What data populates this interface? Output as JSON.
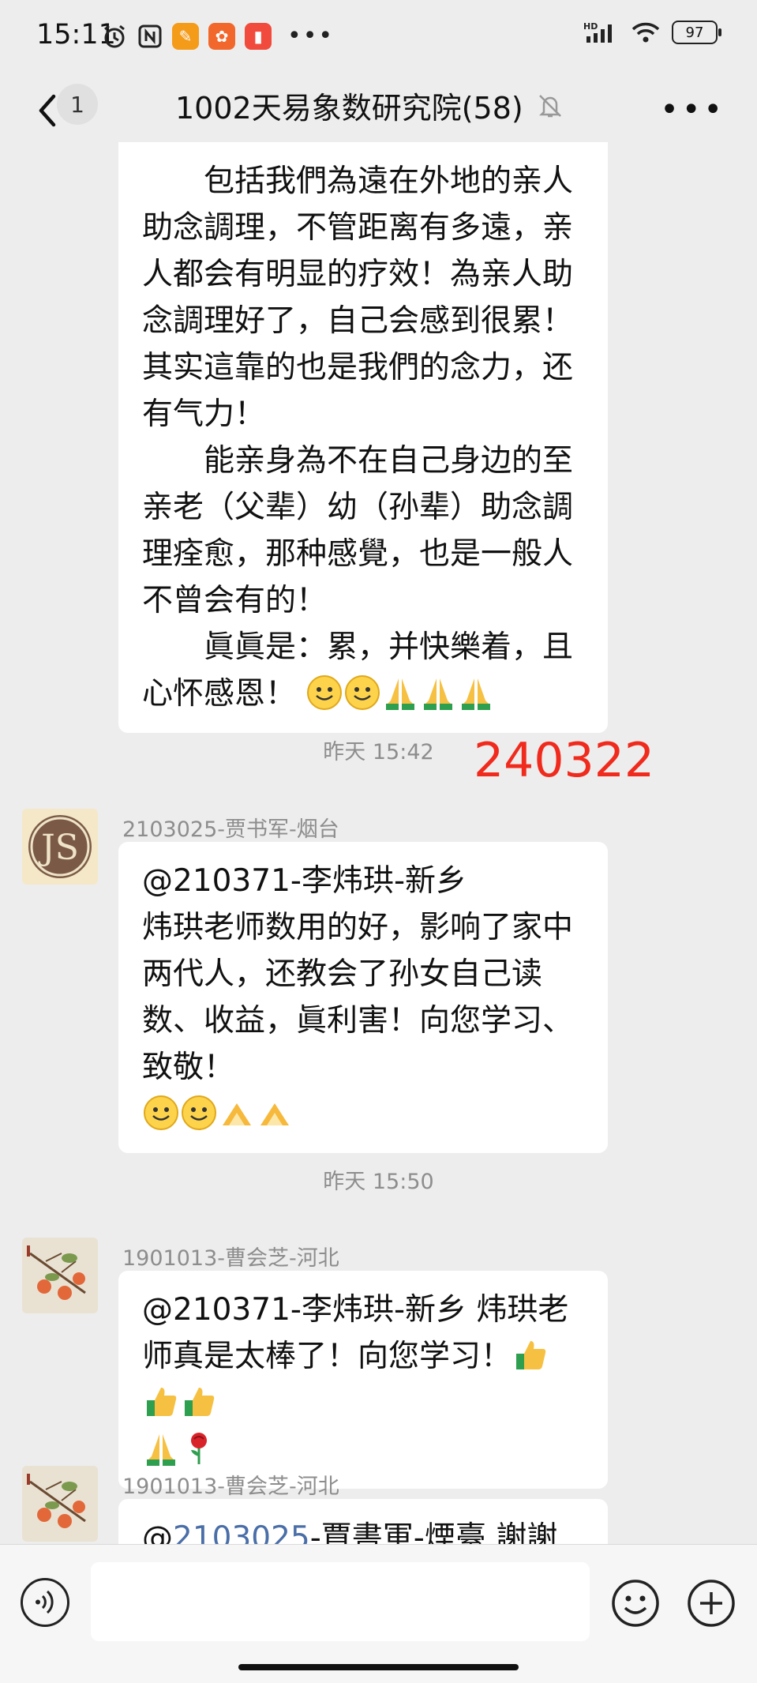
{
  "status_bar": {
    "time": "15:11",
    "battery": "97",
    "network": "HD"
  },
  "nav": {
    "unread_count": "1",
    "title": "1002天易象数研究院(58)"
  },
  "messages": {
    "m1": {
      "para1": "包括我們為遠在外地的亲人助念調理，不管距离有多遠，亲人都会有明显的疗效！為亲人助念調理好了，自己会感到很累！其实這靠的也是我們的念力，还有气力！",
      "para2": "能亲身為不在自己身边的至亲老（父辈）幼（孙辈）助念調理痊愈，那种感覺，也是一般人不曾会有的！",
      "para3": "眞眞是：累，并快樂着，且心怀感恩！"
    },
    "sep1": "昨天 15:42",
    "stamp": "240322",
    "m2": {
      "sender": "2103025-贾书军-烟台",
      "line1": "@210371-李炜珙-新乡",
      "body": "炜珙老师数用的好，影响了家中两代人，还教会了孙女自己读数、收益，眞利害！向您学习、致敬！"
    },
    "sep2": "昨天 15:50",
    "m3": {
      "sender": "1901013-曹会芝-河北",
      "body": "@210371-李炜珙-新乡  炜珙老师真是太棒了！向您学习！"
    },
    "m4": {
      "sender": "1901013-曹会芝-河北",
      "mention_id": "2103025",
      "rest": "-賈書軍-煙臺  謝謝您的"
    }
  },
  "icons": {
    "back": "chevron-left-icon",
    "mute": "bell-off-icon",
    "more": "more-dots-icon",
    "voice": "voice-icon",
    "emoji": "emoji-icon",
    "plus": "plus-icon"
  },
  "colors": {
    "background": "#ededed",
    "bubble": "#ffffff",
    "stamp": "#f02a1c",
    "mention": "#4a6ea8"
  }
}
